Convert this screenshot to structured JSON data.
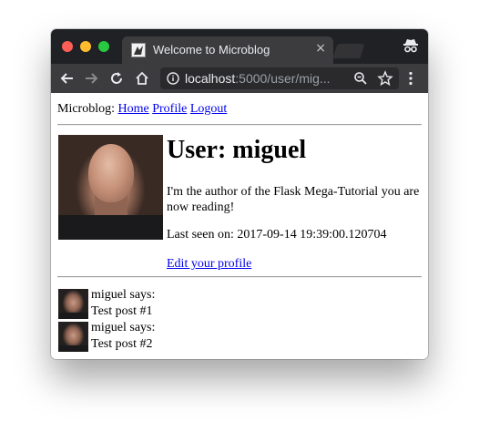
{
  "browser": {
    "tab_title": "Welcome to Microblog",
    "tab_close": "×",
    "url_host": "localhost",
    "url_rest": ":5000/user/mig...",
    "icons": [
      "back-icon",
      "forward-icon",
      "reload-icon",
      "home-icon",
      "info-icon",
      "zoom-icon",
      "star-icon",
      "menu-icon",
      "incognito-icon"
    ],
    "traffic_colors": {
      "close": "#fe5f57",
      "minimize": "#febc2e",
      "maximize": "#28c840"
    }
  },
  "nav": {
    "brand": "Microblog:",
    "links": [
      "Home",
      "Profile",
      "Logout"
    ]
  },
  "profile": {
    "title": "User: miguel",
    "about": "I'm the author of the Flask Mega-Tutorial you are now reading!",
    "last_seen": "Last seen on: 2017-09-14 19:39:00.120704",
    "edit_link": "Edit your profile"
  },
  "posts": [
    {
      "author": "miguel says:",
      "body": "Test post #1"
    },
    {
      "author": "miguel says:",
      "body": "Test post #2"
    }
  ],
  "colors": {
    "link": "#0000ee",
    "chrome_dark": "#202124",
    "chrome_toolbar": "#3c3c3f"
  }
}
